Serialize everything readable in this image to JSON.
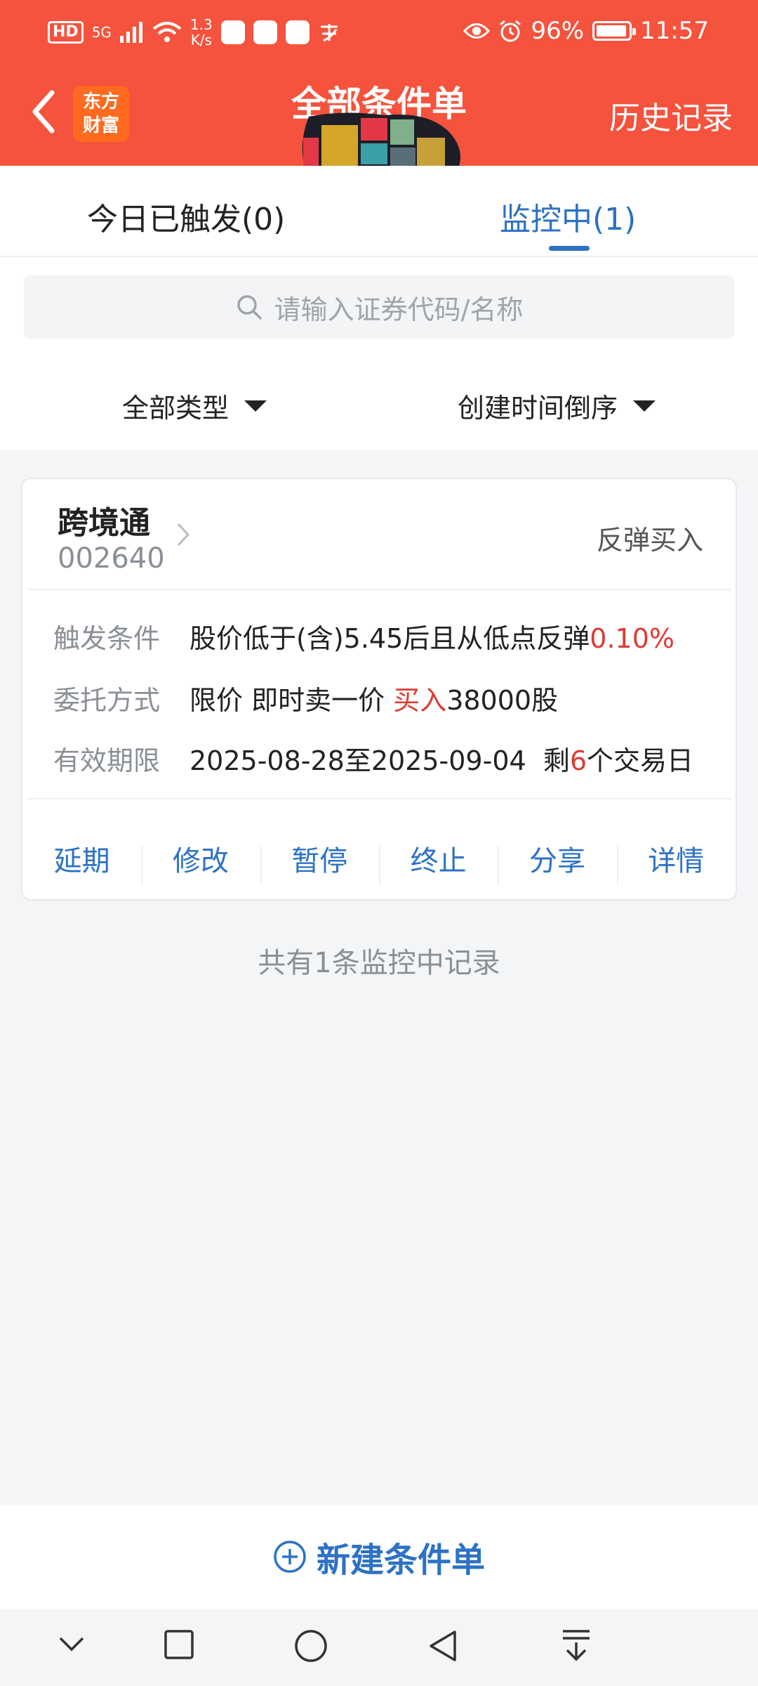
{
  "status_bar": {
    "hd": "HD",
    "signal": "5G",
    "speed_value": "1.3",
    "speed_unit": "K/s",
    "battery": "96%",
    "time": "11:57"
  },
  "header": {
    "logo_line1": "东方",
    "logo_line2": "财富",
    "title": "全部条件单",
    "history": "历史记录"
  },
  "tabs": [
    {
      "label": "今日已触发(0)"
    },
    {
      "label": "监控中(1)"
    }
  ],
  "search": {
    "placeholder": "请输入证券代码/名称"
  },
  "filters": {
    "type": "全部类型",
    "sort": "创建时间倒序"
  },
  "card": {
    "name": "跨境通",
    "code": "002640",
    "order_type": "反弹买入",
    "trigger": {
      "label": "触发条件",
      "text": "股价低于(含)5.45后且从低点反弹",
      "pct": "0.10%"
    },
    "entrust": {
      "label": "委托方式",
      "text": "限价 即时卖一价 ",
      "side": "买入",
      "qty": "38000股"
    },
    "validity": {
      "label": "有效期限",
      "range": "2025-08-28至2025-09-04  剩",
      "days": "6",
      "suffix": "个交易日"
    },
    "actions": [
      "延期",
      "修改",
      "暂停",
      "终止",
      "分享",
      "详情"
    ]
  },
  "footer_note": "共有1条监控中记录",
  "new_button": "新建条件单",
  "colors": {
    "header_red": "#f5533d",
    "accent_blue": "#2d72c4",
    "alert_red": "#e03a33"
  }
}
